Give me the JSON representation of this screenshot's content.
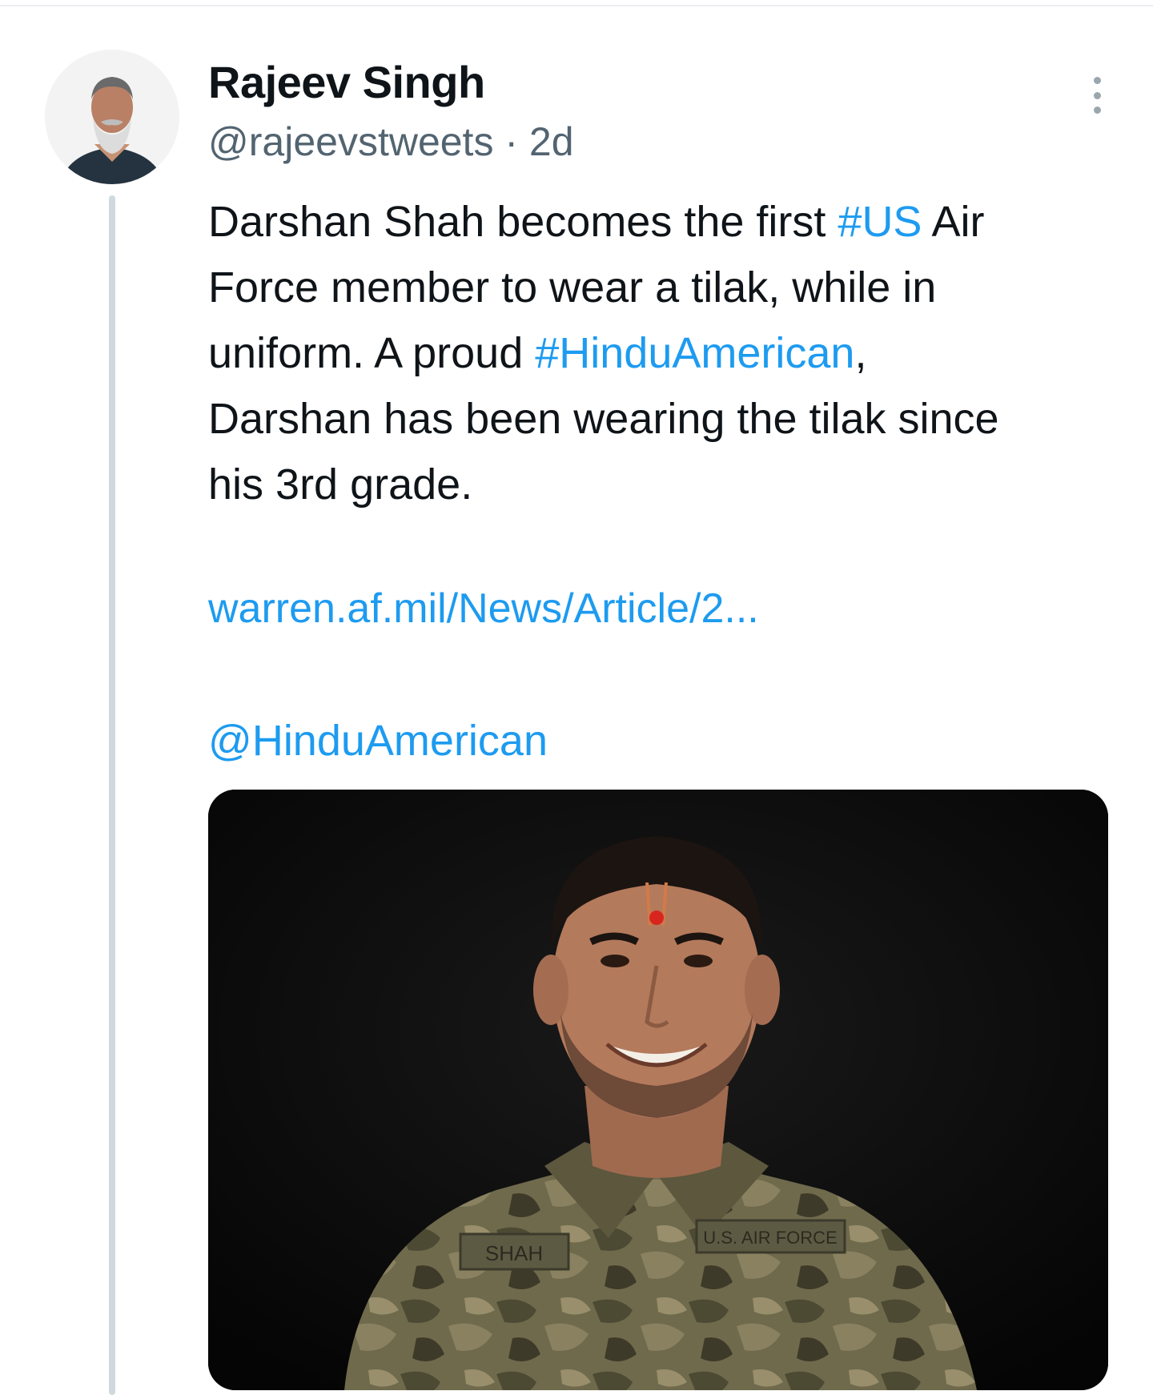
{
  "tweet": {
    "author_name": "Rajeev Singh",
    "handle": "@rajeevstweets",
    "separator": "·",
    "time": "2d",
    "text_lines": [
      {
        "before": "Darshan Shah becomes the first ",
        "link": "#US",
        "after": " Air"
      },
      {
        "before": "Force member to wear a tilak, while in",
        "link": "",
        "after": ""
      },
      {
        "before": "uniform. A proud ",
        "link": "#HinduAmerican",
        "after": ","
      },
      {
        "before": "Darshan has been wearing the tilak since",
        "link": "",
        "after": ""
      },
      {
        "before": "his 3rd grade.",
        "link": "",
        "after": ""
      }
    ],
    "url": "warren.af.mil/News/Article/2...",
    "mention": "@HinduAmerican",
    "media": {
      "name_tape": "SHAH",
      "service_tape": "U.S. AIR FORCE"
    }
  },
  "icons": {
    "more": "more-vertical-icon"
  },
  "colors": {
    "link": "#1d9bf0",
    "text": "#0f1419",
    "secondary": "#536471",
    "thread_line": "#cfd9de"
  }
}
